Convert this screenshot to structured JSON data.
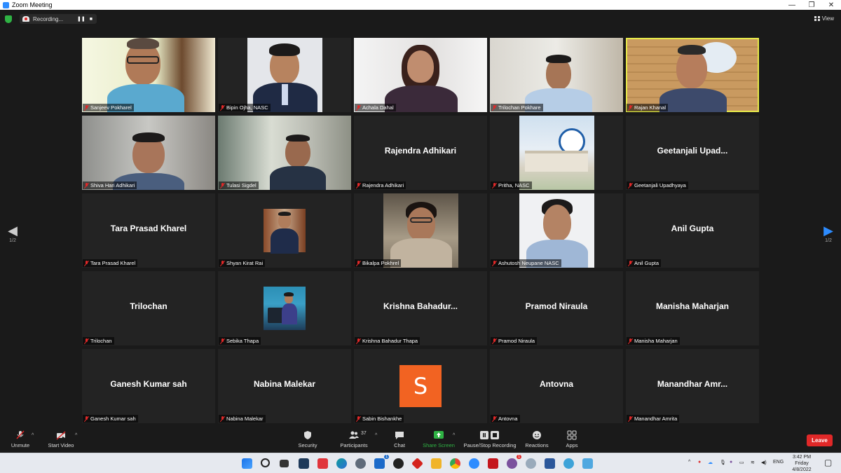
{
  "window": {
    "title": "Zoom Meeting"
  },
  "topbar": {
    "recording_label": "Recording...",
    "pause_glyph": "❚❚",
    "stop_glyph": "■",
    "view_label": "View"
  },
  "paging": {
    "left_page": "1/2",
    "right_page": "1/2"
  },
  "participants": [
    {
      "name": "Sanjeev Pokharel",
      "video": true,
      "active": false
    },
    {
      "name": "Bipin Ojha, NASC",
      "video": true,
      "active": false
    },
    {
      "name": "Achala Dahal",
      "video": true,
      "active": false
    },
    {
      "name": "Trilochan Pokhare",
      "video": true,
      "active": false
    },
    {
      "name": "Rajan Khanal",
      "video": true,
      "active": true
    },
    {
      "name": "Shiva Hari Adhikari",
      "video": true,
      "active": false
    },
    {
      "name": "Tulasi Sigdel",
      "video": true,
      "active": false
    },
    {
      "name": "Rajendra Adhikari",
      "display": "Rajendra Adhikari",
      "video": false
    },
    {
      "name": "Pritha, NASC",
      "video": true,
      "active": false
    },
    {
      "name": "Geetanjali Upadhyaya",
      "display": "Geetanjali Upad...",
      "video": false
    },
    {
      "name": "Tara Prasad Kharel",
      "display": "Tara Prasad Kharel",
      "video": false
    },
    {
      "name": "Shyan Kirat Rai",
      "video": true,
      "active": false
    },
    {
      "name": "Bikalpa Pokhrel",
      "video": true,
      "active": false
    },
    {
      "name": "Ashutosh Neupane NASC",
      "video": true,
      "active": false
    },
    {
      "name": "Anil Gupta",
      "display": "Anil Gupta",
      "video": false
    },
    {
      "name": "Trilochan",
      "display": "Trilochan",
      "video": false
    },
    {
      "name": "Sebika Thapa",
      "video": true,
      "active": false
    },
    {
      "name": "Krishna Bahadur Thapa",
      "display": "Krishna  Bahadur...",
      "video": false
    },
    {
      "name": "Pramod Niraula",
      "display": "Pramod Niraula",
      "video": false
    },
    {
      "name": "Manisha Maharjan",
      "display": "Manisha Maharjan",
      "video": false
    },
    {
      "name": "Ganesh Kumar sah",
      "display": "Ganesh Kumar sah",
      "video": false
    },
    {
      "name": "Nabina Malekar",
      "display": "Nabina Malekar",
      "video": false
    },
    {
      "name": "Sabin Bishankhe",
      "avatar_letter": "S",
      "video": false
    },
    {
      "name": "Antovna",
      "display": "Antovna",
      "video": false
    },
    {
      "name": "Manandhar Amrita",
      "display": "Manandhar  Amr...",
      "video": false
    }
  ],
  "toolbar": {
    "unmute": "Unmute",
    "start_video": "Start Video",
    "security": "Security",
    "participants": "Participants",
    "participant_count": "37",
    "chat": "Chat",
    "share_screen": "Share Screen",
    "pause_stop_recording": "Pause/Stop Recording",
    "reactions": "Reactions",
    "apps": "Apps",
    "leave": "Leave"
  },
  "taskbar": {
    "language": "ENG",
    "time": "3:42 PM",
    "day": "Friday",
    "date": "4/8/2022",
    "mail_badge": "1",
    "viber_badge": "1"
  },
  "colors": {
    "accent": "#2d8cff",
    "active_speaker": "#e6e94a",
    "leave": "#e02828",
    "share": "#2fb344",
    "avatar": "#f26322"
  }
}
